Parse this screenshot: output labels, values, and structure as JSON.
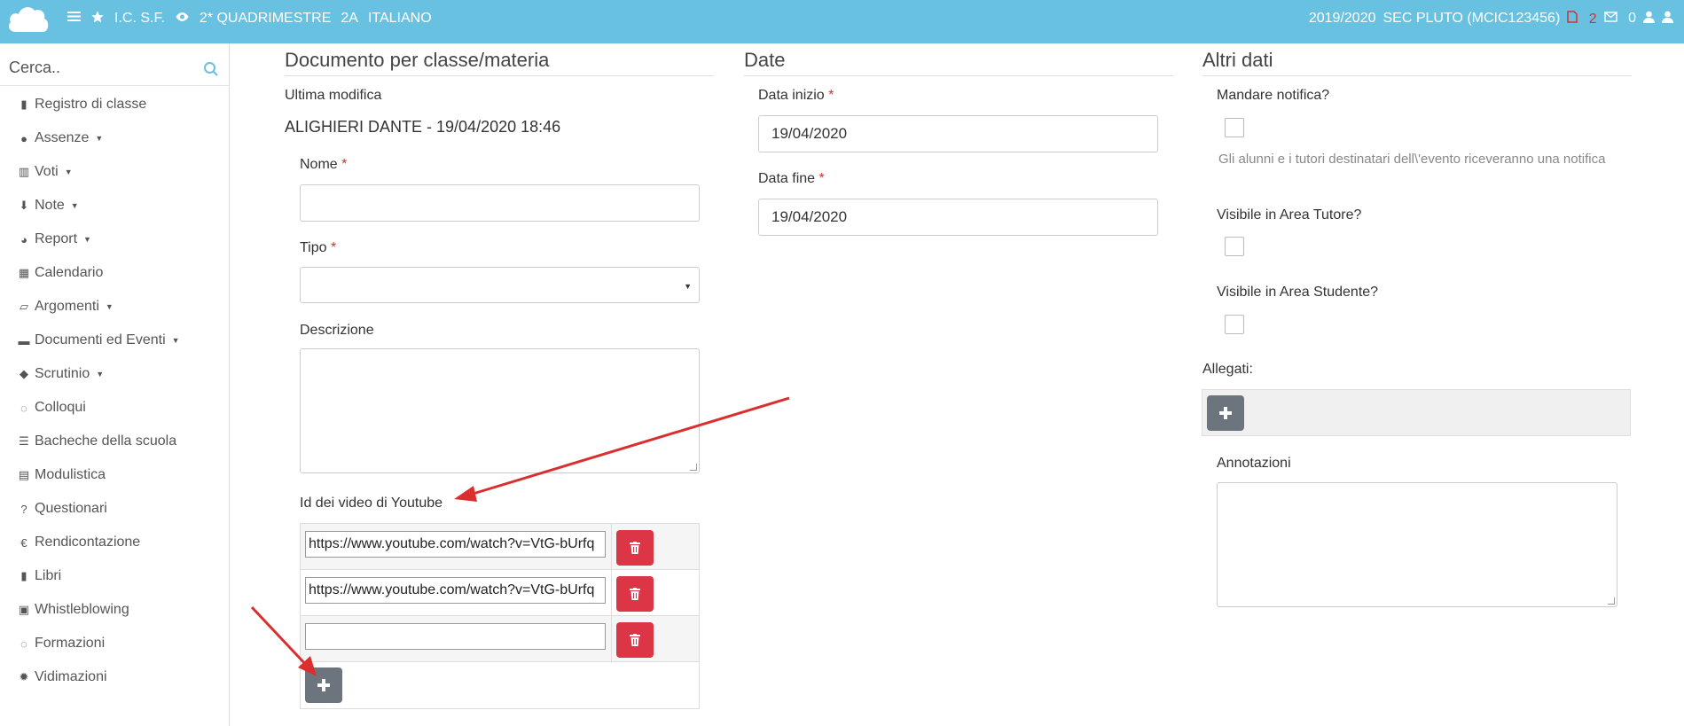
{
  "topbar": {
    "school": "I.C. S.F.",
    "period": "2* QUADRIMESTRE",
    "class": "2A",
    "subject": "ITALIANO",
    "year": "2019/2020",
    "institute": "SEC PLUTO (MCIC123456)",
    "doc_count": "2",
    "mail_count": "0"
  },
  "sidebar": {
    "search_placeholder": "Cerca..",
    "items": [
      {
        "label": "Registro di classe",
        "icon": "book-icon",
        "caret": false
      },
      {
        "label": "Assenze",
        "icon": "user-icon",
        "caret": true
      },
      {
        "label": "Voti",
        "icon": "bank-icon",
        "caret": true
      },
      {
        "label": "Note",
        "icon": "pin-icon",
        "caret": true
      },
      {
        "label": "Report",
        "icon": "pie-chart-icon",
        "caret": true
      },
      {
        "label": "Calendario",
        "icon": "calendar-icon",
        "caret": false
      },
      {
        "label": "Argomenti",
        "icon": "folder-open-icon",
        "caret": true
      },
      {
        "label": "Documenti ed Eventi",
        "icon": "archive-icon",
        "caret": true
      },
      {
        "label": "Scrutinio",
        "icon": "graduation-cap-icon",
        "caret": true
      },
      {
        "label": "Colloqui",
        "icon": "comments-icon",
        "caret": false
      },
      {
        "label": "Bacheche della scuola",
        "icon": "list-icon",
        "caret": false
      },
      {
        "label": "Modulistica",
        "icon": "documents-icon",
        "caret": false
      },
      {
        "label": "Questionari",
        "icon": "question-icon",
        "caret": false
      },
      {
        "label": "Rendicontazione",
        "icon": "euro-icon",
        "caret": false
      },
      {
        "label": "Libri",
        "icon": "book-icon",
        "caret": false
      },
      {
        "label": "Whistleblowing",
        "icon": "lock-icon",
        "caret": false
      },
      {
        "label": "Formazioni",
        "icon": "comments-icon",
        "caret": false
      },
      {
        "label": "Vidimazioni",
        "icon": "certificate-icon",
        "caret": false
      }
    ]
  },
  "doc": {
    "title": "Documento per classe/materia",
    "last_modified_label": "Ultima modifica",
    "last_modified_value": "ALIGHIERI DANTE - 19/04/2020 18:46",
    "name_label": "Nome",
    "name_value": "",
    "type_label": "Tipo",
    "type_value": "",
    "description_label": "Descrizione",
    "youtube_label": "Id dei video di Youtube",
    "youtube_videos": [
      "https://www.youtube.com/watch?v=VtG-bUrfq",
      "https://www.youtube.com/watch?v=VtG-bUrfq",
      ""
    ]
  },
  "dates": {
    "title": "Date",
    "start_label": "Data inizio",
    "start_value": "19/04/2020",
    "end_label": "Data fine",
    "end_value": "19/04/2020"
  },
  "other": {
    "title": "Altri dati",
    "notify_label": "Mandare notifica?",
    "notify_help": "Gli alunni e i tutori destinatari dell\\'evento riceveranno una notifica",
    "tutor_label": "Visibile in Area Tutore?",
    "student_label": "Visibile in Area Studente?",
    "attachments_label": "Allegati:",
    "notes_label": "Annotazioni"
  },
  "colors": {
    "topbar": "#69c1e1",
    "danger": "#dc3545",
    "secondary": "#6c757d",
    "required": "#d9302f",
    "annotation_arrow": "#d9302f"
  }
}
